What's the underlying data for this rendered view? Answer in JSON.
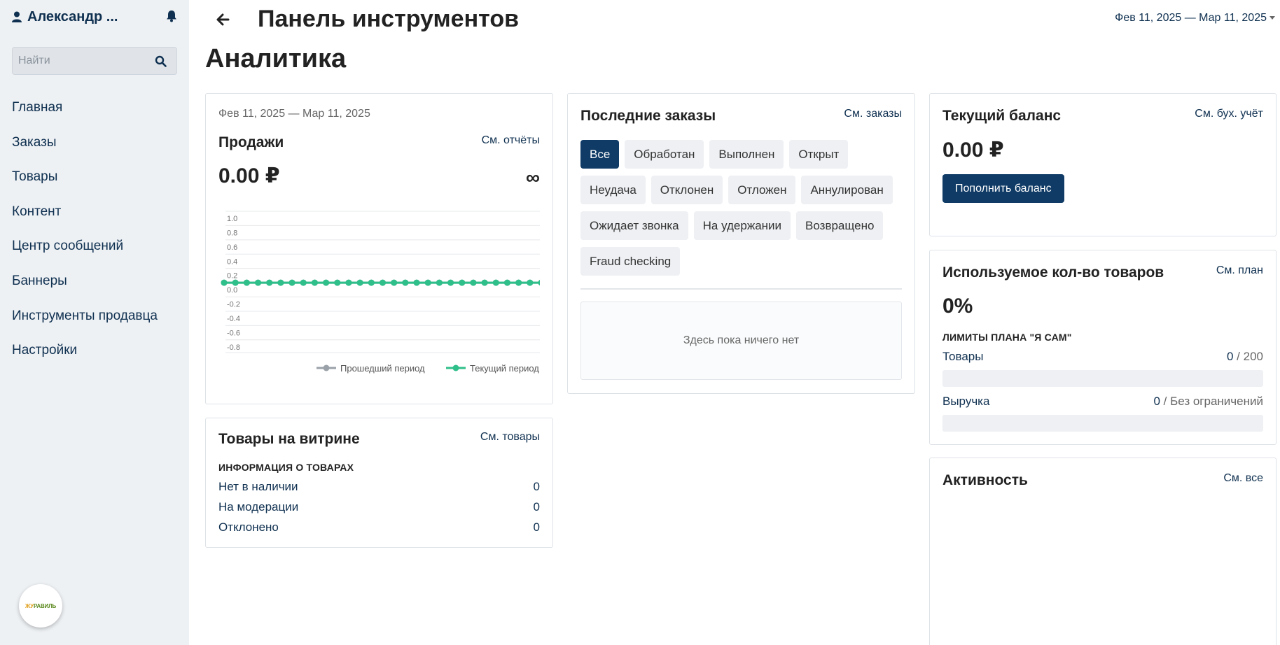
{
  "sidebar": {
    "user_name": "Александр ...",
    "search_placeholder": "Найти",
    "items": [
      {
        "label": "Главная"
      },
      {
        "label": "Заказы"
      },
      {
        "label": "Товары"
      },
      {
        "label": "Контент"
      },
      {
        "label": "Центр сообщений"
      },
      {
        "label": "Баннеры"
      },
      {
        "label": "Инструменты продавца"
      },
      {
        "label": "Настройки"
      }
    ],
    "logo_text_a": "ЖУ",
    "logo_text_b": "РАВИЛЬ"
  },
  "header": {
    "title": "Панель инструментов",
    "date_range": "Фев 11, 2025 — Мар 11, 2025"
  },
  "analytics_title": "Аналитика",
  "sales": {
    "period": "Фев 11, 2025 — Мар 11, 2025",
    "title": "Продажи",
    "link": "См. отчёты",
    "amount": "0.00 ₽",
    "change": "∞"
  },
  "chart_data": {
    "type": "line",
    "title": "",
    "xlabel": "",
    "ylabel": "",
    "ylim": [
      -0.9,
      1.0
    ],
    "y_ticks": [
      "1.0",
      "0.8",
      "0.6",
      "0.4",
      "0.2",
      "0.0",
      "-0.2",
      "-0.4",
      "-0.6",
      "-0.8"
    ],
    "x": [
      1,
      2,
      3,
      4,
      5,
      6,
      7,
      8,
      9,
      10,
      11,
      12,
      13,
      14,
      15,
      16,
      17,
      18,
      19,
      20,
      21,
      22,
      23,
      24,
      25,
      26,
      27,
      28,
      29
    ],
    "series": [
      {
        "name": "Прошедший период",
        "values": [
          0,
          0,
          0,
          0,
          0,
          0,
          0,
          0,
          0,
          0,
          0,
          0,
          0,
          0,
          0,
          0,
          0,
          0,
          0,
          0,
          0,
          0,
          0,
          0,
          0,
          0,
          0,
          0,
          0
        ],
        "color": "#9aa1a8"
      },
      {
        "name": "Текущий период",
        "values": [
          0,
          0,
          0,
          0,
          0,
          0,
          0,
          0,
          0,
          0,
          0,
          0,
          0,
          0,
          0,
          0,
          0,
          0,
          0,
          0,
          0,
          0,
          0,
          0,
          0,
          0,
          0,
          0,
          0
        ],
        "color": "#2fbf8a"
      }
    ],
    "grid": true,
    "legend": "bottom-right"
  },
  "storefront": {
    "title": "Товары на витрине",
    "link": "См. товары",
    "section": "ИНФОРМАЦИЯ О ТОВАРАХ",
    "rows": [
      {
        "label": "Нет в наличии",
        "value": "0"
      },
      {
        "label": "На модерации",
        "value": "0"
      },
      {
        "label": "Отклонено",
        "value": "0"
      }
    ]
  },
  "orders": {
    "title": "Последние заказы",
    "link": "См. заказы",
    "filters": [
      "Все",
      "Обработан",
      "Выполнен",
      "Открыт",
      "Неудача",
      "Отклонен",
      "Отложен",
      "Аннулирован",
      "Ожидает звонка",
      "На удержании",
      "Возвращено",
      "Fraud checking"
    ],
    "active_filter": "Все",
    "empty": "Здесь пока ничего нет"
  },
  "balance": {
    "title": "Текущий баланс",
    "link": "См. бух. учёт",
    "amount": "0.00 ₽",
    "button": "Пополнить баланс"
  },
  "usage": {
    "title": "Используемое кол-во товаров",
    "link": "См. план",
    "percent": "0%",
    "section": "ЛИМИТЫ ПЛАНА \"Я САМ\"",
    "rows": [
      {
        "label": "Товары",
        "used": "0",
        "limit": " / 200",
        "fill": 0
      },
      {
        "label": "Выручка",
        "used": "0",
        "limit": " / Без ограничений",
        "fill": 0
      }
    ]
  },
  "activity": {
    "title": "Активность",
    "link": "См. все"
  },
  "colors": {
    "primary": "#0f3b66",
    "text_link": "#0f3050",
    "current_series": "#2fbf8a",
    "previous_series": "#9aa1a8"
  }
}
